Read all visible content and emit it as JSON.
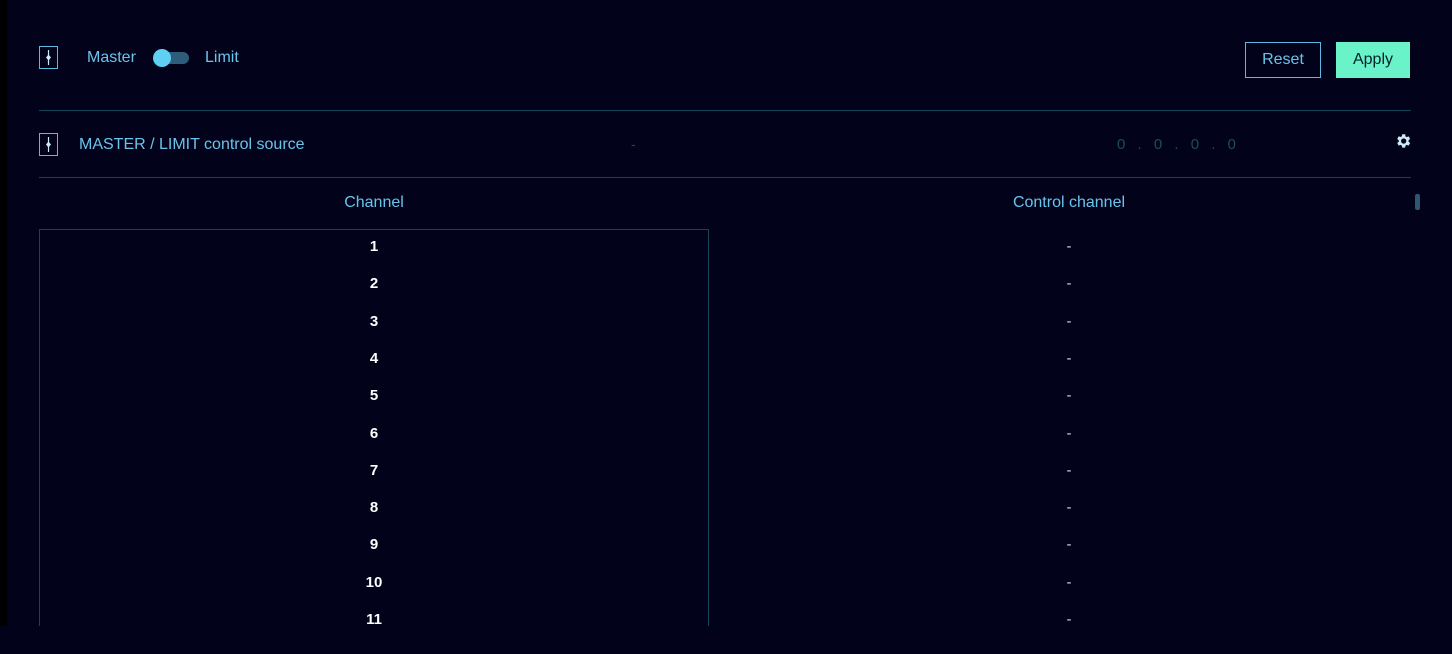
{
  "header": {
    "master_label": "Master",
    "limit_label": "Limit",
    "toggle_state": "master",
    "reset_label": "Reset",
    "apply_label": "Apply"
  },
  "source": {
    "label": "MASTER / LIMIT control source",
    "value": "-",
    "ip": "0.0.0.0"
  },
  "table": {
    "channel_header": "Channel",
    "control_header": "Control channel",
    "rows": [
      {
        "channel": "1",
        "control": "-"
      },
      {
        "channel": "2",
        "control": "-"
      },
      {
        "channel": "3",
        "control": "-"
      },
      {
        "channel": "4",
        "control": "-"
      },
      {
        "channel": "5",
        "control": "-"
      },
      {
        "channel": "6",
        "control": "-"
      },
      {
        "channel": "7",
        "control": "-"
      },
      {
        "channel": "8",
        "control": "-"
      },
      {
        "channel": "9",
        "control": "-"
      },
      {
        "channel": "10",
        "control": "-"
      },
      {
        "channel": "11",
        "control": "-"
      }
    ]
  },
  "icons": {
    "mode_icon": "fader-icon",
    "source_icon": "fader-icon",
    "settings_icon": "gear-icon"
  },
  "colors": {
    "background": "#02031a",
    "accent": "#69c4ec",
    "apply": "#6af3c9",
    "divider": "#14435a"
  }
}
